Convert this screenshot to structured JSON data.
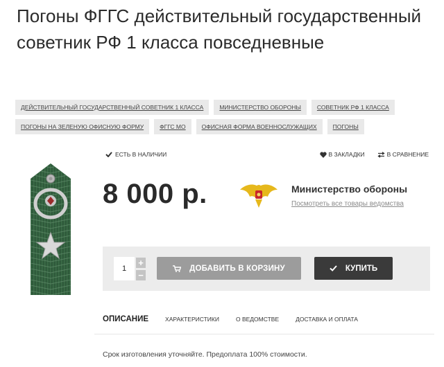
{
  "product": {
    "title": "Погоны ФГГС действительный государственный советник РФ 1 класса повседневные",
    "price": "8 000 р.",
    "stock_status": "ЕСТЬ В НАЛИЧИИ"
  },
  "tags": [
    [
      "ДЕЙСТВИТЕЛЬНЫЙ ГОСУДАРСТВЕННЫЙ СОВЕТНИК 1 КЛАССА",
      "МИНИСТЕРСТВО ОБОРОНЫ",
      "СОВЕТНИК РФ 1 КЛАССА"
    ],
    [
      "ПОГОНЫ НА ЗЕЛЕНУЮ ОФИСНУЮ ФОРМУ",
      "ФГГС МО",
      "ОФИСНАЯ ФОРМА ВОЕННОСЛУЖАЩИХ",
      "ПОГОНЫ"
    ]
  ],
  "top_actions": {
    "bookmark": "В ЗАКЛАДКИ",
    "compare": "В СРАВНЕНИЕ"
  },
  "brand": {
    "name": "Министерство обороны",
    "link": "Посмотреть все товары ведомства"
  },
  "purchase": {
    "quantity": "1",
    "plus": "+",
    "minus": "−",
    "add_to_cart": "ДОБАВИТЬ В КОРЗИНУ",
    "buy": "КУПИТЬ"
  },
  "tabs": [
    "ОПИСАНИЕ",
    "ХАРАКТЕРИСТИКИ",
    "О ВЕДОМСТВЕ",
    "ДОСТАВКА И ОПЛАТА"
  ],
  "description": "Срок изготовления уточняйте. Предоплата 100% стоимости.",
  "icons": {
    "stock": "check-icon",
    "bookmark": "heart-icon",
    "compare": "arrows-icon",
    "cart": "cart-icon",
    "buy": "check-icon"
  },
  "colors": {
    "shoulder_board": "#2f5a3b",
    "buy_button": "#3a3a3a",
    "cart_button": "#9c9c9c",
    "buy_box": "#ececec",
    "tag_bg": "#e9e9e9"
  }
}
